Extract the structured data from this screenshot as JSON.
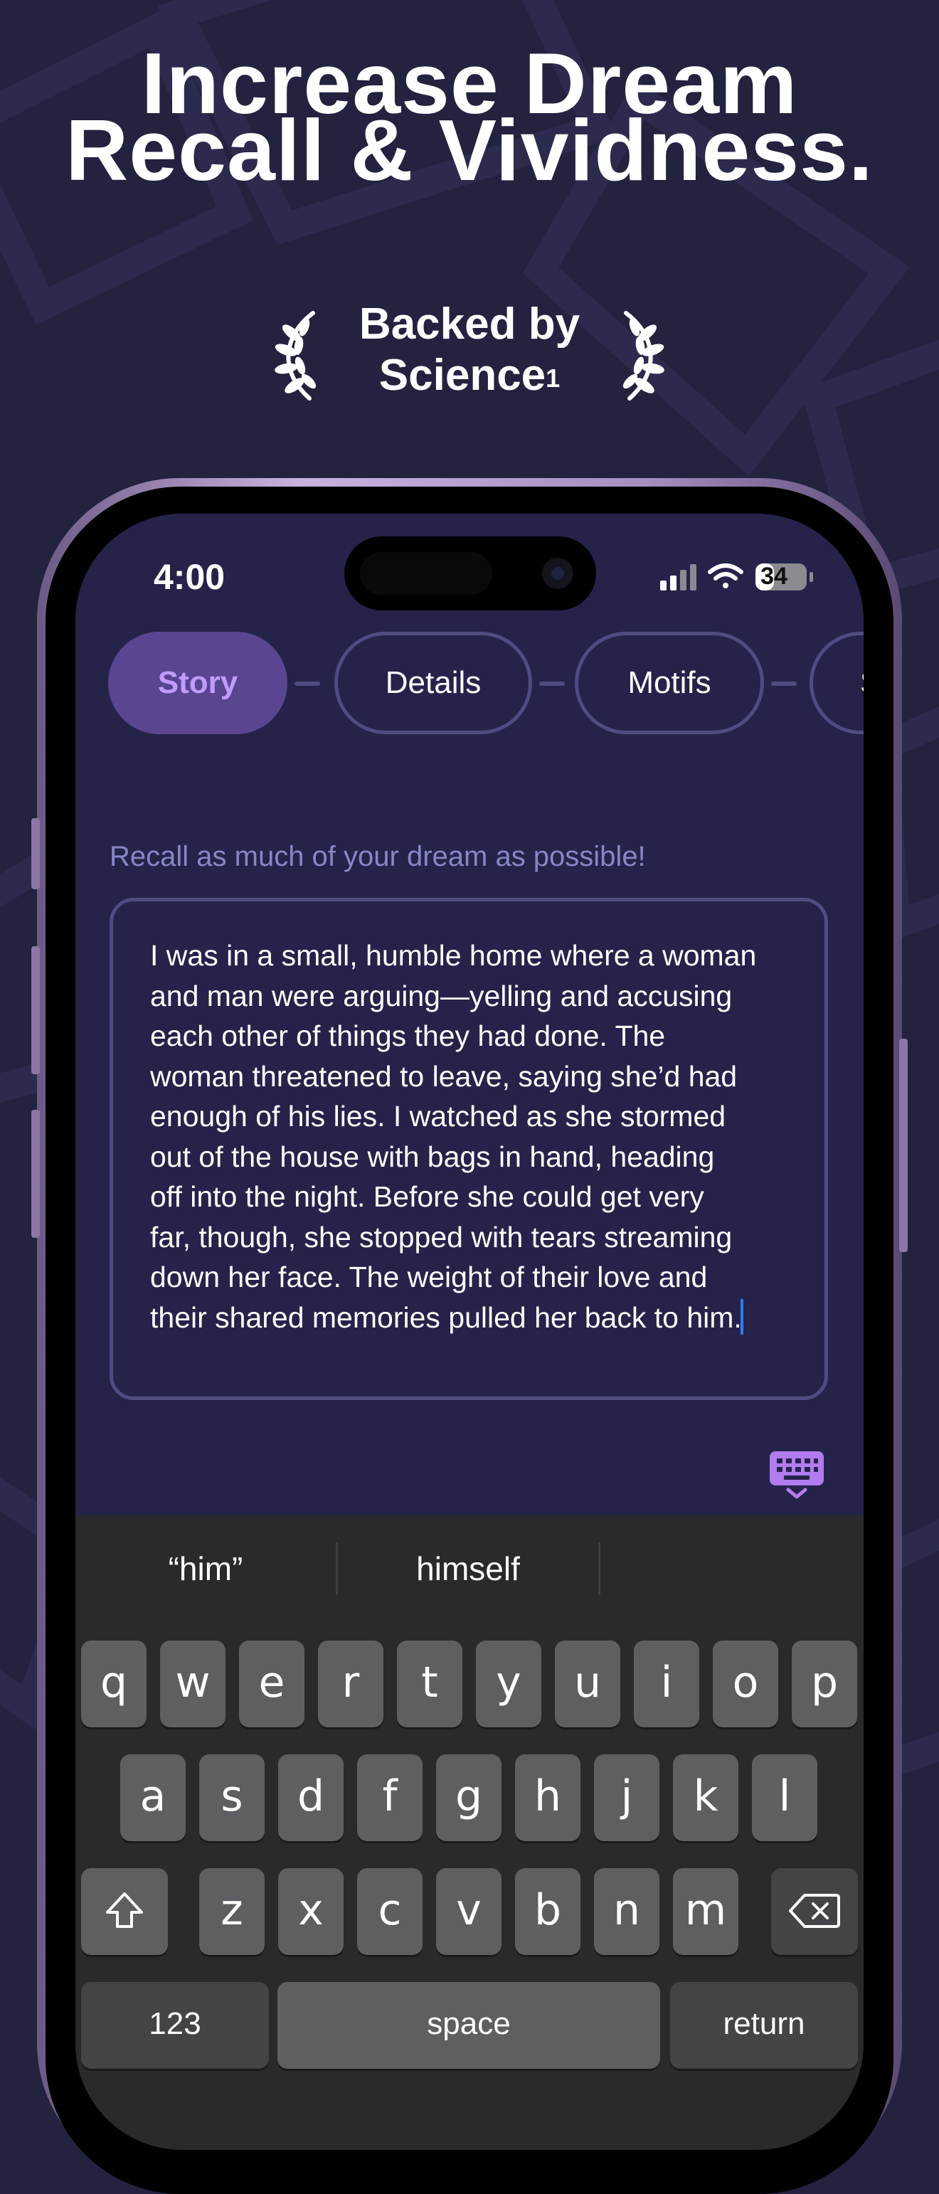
{
  "promo": {
    "headline_line1": "Increase Dream",
    "headline_line2": "Recall & Vividness.",
    "badge_line1": "Backed by",
    "badge_line2": "Science",
    "badge_sup": "1"
  },
  "status_bar": {
    "time": "4:00",
    "battery": "34"
  },
  "steps": [
    {
      "label": "Story",
      "active": true
    },
    {
      "label": "Details",
      "active": false
    },
    {
      "label": "Motifs",
      "active": false
    },
    {
      "label": "S",
      "active": false
    }
  ],
  "editor": {
    "hint": "Recall as much of your dream as possible!",
    "lines": [
      "I was in a small, humble home where a woman",
      "and man were arguing—yelling and accusing",
      "each other of things they had done. The",
      "woman threatened to leave, saying she’d had",
      "enough of his lies. I watched as she stormed",
      "out of the house with bags in hand, heading",
      "off into the night. Before she could get very",
      "far, though, she stopped with tears streaming",
      "down her face. The weight of their love and",
      "their shared memories pulled her back to him."
    ]
  },
  "keyboard": {
    "suggestions": [
      "“him”",
      "himself",
      ""
    ],
    "row1": [
      "q",
      "w",
      "e",
      "r",
      "t",
      "y",
      "u",
      "i",
      "o",
      "p"
    ],
    "row2": [
      "a",
      "s",
      "d",
      "f",
      "g",
      "h",
      "j",
      "k",
      "l"
    ],
    "row3": [
      "z",
      "x",
      "c",
      "v",
      "b",
      "n",
      "m"
    ],
    "numbers_label": "123",
    "space_label": "space",
    "return_label": "return",
    "shift_icon": "shift-icon",
    "delete_icon": "delete-icon"
  },
  "colors": {
    "background": "#23223f",
    "accent": "#5a4690",
    "accent_text": "#c09bff",
    "outline": "#4d4d82"
  }
}
